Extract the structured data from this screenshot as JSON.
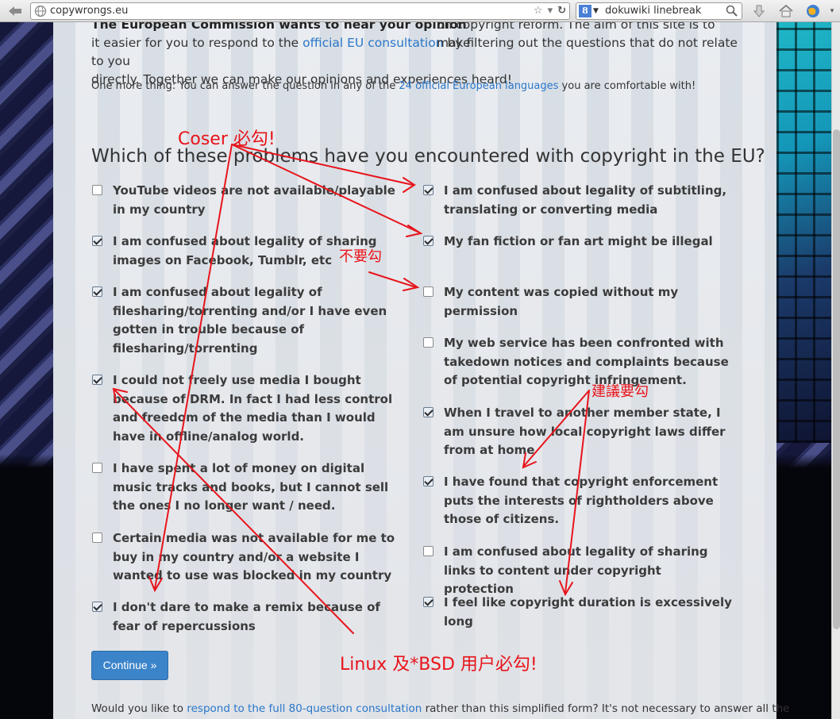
{
  "browser": {
    "url": "copywrongs.eu",
    "search_value": "dokuwiki linebreak",
    "search_engine_badge": "8"
  },
  "intro": {
    "cut_bold": "The European Commission wants to hear your opinion",
    "cut_rest": "on copyright reform. The aim of this site is to make",
    "line1_pre": "it easier for you to respond to the ",
    "line1_link": "official EU consultation",
    "line1_post": " by filtering out the questions that do not relate to you",
    "line2": "directly. Together we can make our opinions and experiences heard!",
    "note_pre": "One more thing: You can answer the question in any of the ",
    "note_link": "24 official European languages",
    "note_post": " you are comfortable with!"
  },
  "question": "Which of these problems have you encountered with copyright in the EU?",
  "options_left": [
    {
      "label": "YouTube videos are not available/playable in my country",
      "checked": false
    },
    {
      "label": "I am confused about legality of sharing images on Facebook, Tumblr, etc",
      "checked": true
    },
    {
      "label": "I am confused about legality of filesharing/torrenting and/or I have even gotten in trouble because of filesharing/torrenting",
      "checked": true
    },
    {
      "label": "I could not freely use media I bought because of DRM. In fact I had less control and freedom of the media than I would have in offline/analog world.",
      "checked": true
    },
    {
      "label": "I have spent a lot of money on digital music tracks and books, but I cannot sell the ones I no longer want / need.",
      "checked": false
    },
    {
      "label": "Certain media was not available for me to buy in my country and/or a website I wanted to use was blocked in my country",
      "checked": false
    },
    {
      "label": "I don't dare to make a remix because of fear of repercussions",
      "checked": true
    }
  ],
  "options_right": [
    {
      "label": "I am confused about legality of subtitling, translating or converting media",
      "checked": true
    },
    {
      "label": "My fan fiction or fan art might be illegal",
      "checked": true
    },
    {
      "label": "My content was copied without my permission",
      "checked": false
    },
    {
      "label": "My web service has been confronted with takedown notices and complaints because of potential copyright infringement.",
      "checked": false
    },
    {
      "label": "When I travel to another member state, I am unsure how local copyright laws differ from at home",
      "checked": true
    },
    {
      "label": "I have found that copyright enforcement puts the interests of rightholders above those of citizens.",
      "checked": true
    },
    {
      "label": "I am confused about legality of sharing links to content under copyright protection",
      "checked": false
    },
    {
      "label": "I feel like copyright duration is excessively long",
      "checked": true
    }
  ],
  "continue_label": "Continue »",
  "footer": {
    "pre": "Would you like to ",
    "link": "respond to the full 80-question consultation",
    "post": " rather than this simplified form? It's not necessary to answer all the"
  },
  "annotations": {
    "coser": "Coser 必勾!",
    "buyao": "不要勾",
    "jianyi": "建議要勾",
    "linux": "Linux 及*BSD 用户必勾!"
  },
  "colors": {
    "annotation": "#e8141b",
    "link": "#2a77c9",
    "button": "#3b84c9"
  }
}
